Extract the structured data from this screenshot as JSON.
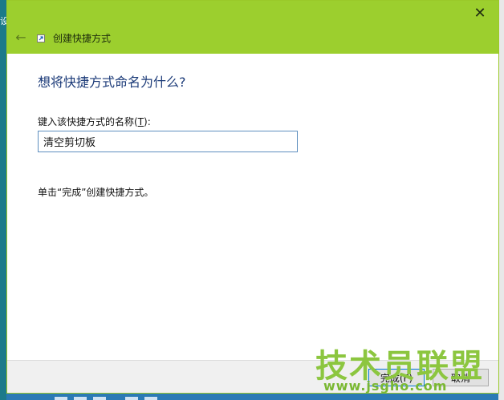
{
  "background": {
    "left_edge_text": "设"
  },
  "dialog": {
    "title": "创建快捷方式",
    "close_glyph": "✕",
    "back_glyph": "←",
    "heading": "想将快捷方式命名为什么?",
    "field_label_prefix": "键入该快捷方式的名称(",
    "field_label_key": "T",
    "field_label_suffix": "):",
    "name_value": "清空剪切板",
    "hint": "单击“完成”创建快捷方式。",
    "finish_label": "完成(F)",
    "cancel_label": "取消"
  },
  "watermark": {
    "brand": "技术员联盟",
    "domain": "www.jsgho.com"
  },
  "colors": {
    "titlebar": "#9ccf2e",
    "heading": "#1b3a78",
    "input_border": "#5e8fbf",
    "watermark": "#8cc63f"
  }
}
